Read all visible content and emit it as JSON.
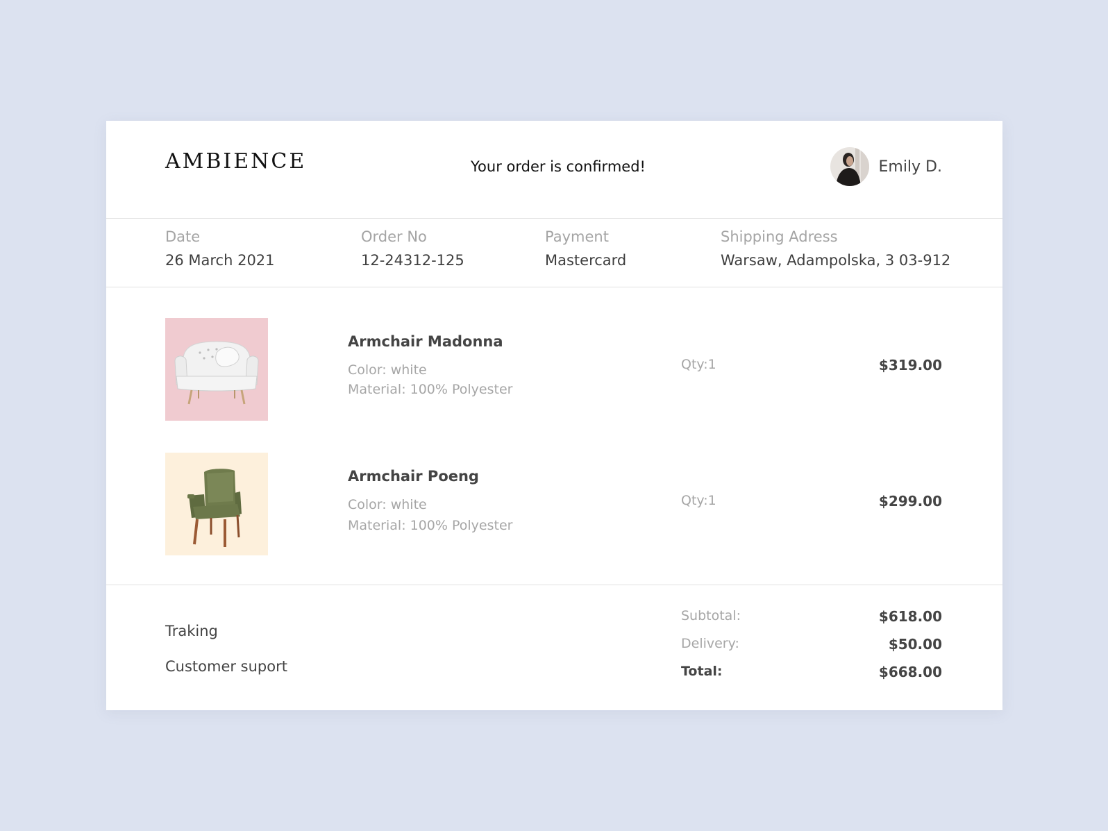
{
  "header": {
    "logo": "AMBIENCE",
    "message": "Your order is confirmed!",
    "user_name": "Emily D."
  },
  "order_info": [
    {
      "label": "Date",
      "value": "26 March 2021"
    },
    {
      "label": "Order No",
      "value": "12-24312-125"
    },
    {
      "label": "Payment",
      "value": "Mastercard"
    },
    {
      "label": "Shipping Adress",
      "value": "Warsaw, Adampolska, 3 03-912"
    }
  ],
  "products": [
    {
      "name": "Armchair Madonna",
      "color": "Color: white",
      "material": "Material: 100% Polyester",
      "qty": "Qty:1",
      "price": "$319.00",
      "thumb_bg": "#f0cbd0"
    },
    {
      "name": "Armchair Poeng",
      "color": "Color: white",
      "material": "Material: 100% Polyester",
      "qty": "Qty:1",
      "price": "$299.00",
      "thumb_bg": "#fdf0dc"
    }
  ],
  "footer": {
    "links": [
      "Traking",
      "Customer suport"
    ],
    "subtotal_label": "Subtotal:",
    "subtotal_value": "$618.00",
    "delivery_label": "Delivery:",
    "delivery_value": "$50.00",
    "total_label": "Total:",
    "total_value": "$668.00"
  },
  "colors": {
    "page_background": "#dce2f0",
    "card_background": "#ffffff",
    "muted_text": "#a6a6a6",
    "primary_text": "#444444"
  }
}
